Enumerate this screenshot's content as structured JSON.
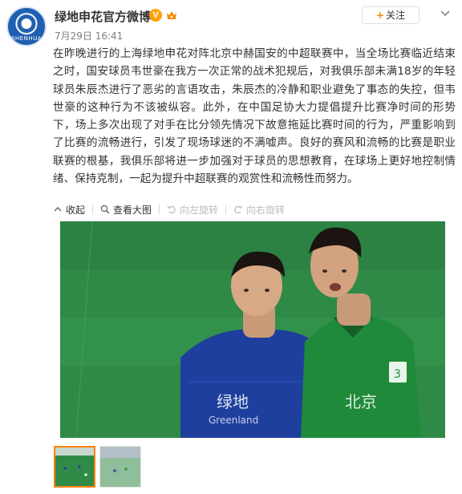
{
  "account": {
    "name": "绿地申花官方微博",
    "verified_mark": "V",
    "avatar_text": "SHENHUA",
    "timestamp": "7月29日 16:41"
  },
  "follow_button": {
    "plus": "+",
    "label": "关注"
  },
  "post": {
    "text": "在昨晚进行的上海绿地申花对阵北京中赫国安的中超联赛中，当全场比赛临近结束之时，国安球员韦世豪在我方一次正常的战术犯规后，对我俱乐部未满18岁的年轻球员朱辰杰进行了恶劣的言语攻击，朱辰杰的冷静和职业避免了事态的失控，但韦世豪的这种行为不该被纵容。此外，在中国足协大力提倡提升比赛净时间的形势下，场上多次出现了对手在比分领先情况下故意拖延比赛时间的行为，严重影响到了比赛的流畅进行，引发了现场球迷的不满嘘声。良好的赛风和流畅的比赛是职业联赛的根基，我俱乐部将进一步加强对于球员的思想教育，在球场上更好地控制情绪、保持克制，一起为提升中超联赛的观赏性和流畅性而努力。"
  },
  "toolbar": {
    "collapse": "收起",
    "view_large": "查看大图",
    "rotate_left": "向左旋转",
    "rotate_right": "向右旋转"
  },
  "image": {
    "left_jersey_text_1": "绿地",
    "left_jersey_text_2": "Greenland",
    "right_jersey_text": "北京",
    "jersey_number": "3"
  },
  "colors": {
    "accent": "#ff8200",
    "verified": "#ffa00a",
    "shenhua_blue": "#1f5fb0",
    "guoan_green": "#1f8a3a"
  }
}
